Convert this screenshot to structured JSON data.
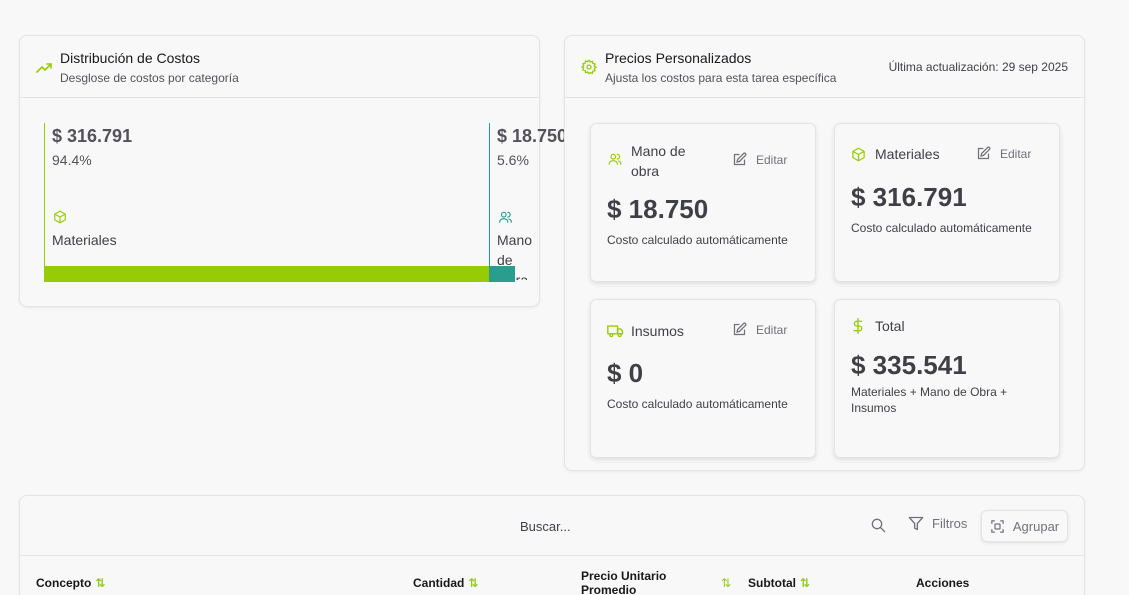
{
  "colors": {
    "accent": "#97cc04",
    "teal": "#2a9d8f"
  },
  "distribution": {
    "title": "Distribución de Costos",
    "subtitle": "Desglose de costos por categoría",
    "segments": [
      {
        "amount": "$ 316.791",
        "percent": "94.4%",
        "label": "Materiales",
        "share": 94.4,
        "icon": "box-icon"
      },
      {
        "amount": "$ 18.750",
        "percent": "5.6%",
        "label": "Mano de Obra",
        "share": 5.6,
        "icon": "users-icon"
      }
    ]
  },
  "prices": {
    "title": "Precios Personalizados",
    "subtitle": "Ajusta los costos para esta tarea específica",
    "updated": "Última actualización: 29 sep 2025",
    "cards": {
      "labor": {
        "title": "Mano de obra",
        "edit": "Editar",
        "amount": "$ 18.750",
        "desc": "Costo calculado automáticamente"
      },
      "materials": {
        "title": "Materiales",
        "edit": "Editar",
        "amount": "$ 316.791",
        "desc": "Costo calculado automáticamente"
      },
      "supplies": {
        "title": "Insumos",
        "edit": "Editar",
        "amount": "$ 0",
        "desc": "Costo calculado automáticamente"
      },
      "total": {
        "title": "Total",
        "amount": "$ 335.541",
        "desc": "Materiales + Mano de Obra + Insumos"
      }
    }
  },
  "table": {
    "search_placeholder": "Buscar...",
    "filters_label": "Filtros",
    "group_label": "Agrupar",
    "columns": {
      "concept": "Concepto",
      "quantity": "Cantidad",
      "unit_price": "Precio Unitario Promedio",
      "subtotal": "Subtotal",
      "actions": "Acciones"
    }
  }
}
